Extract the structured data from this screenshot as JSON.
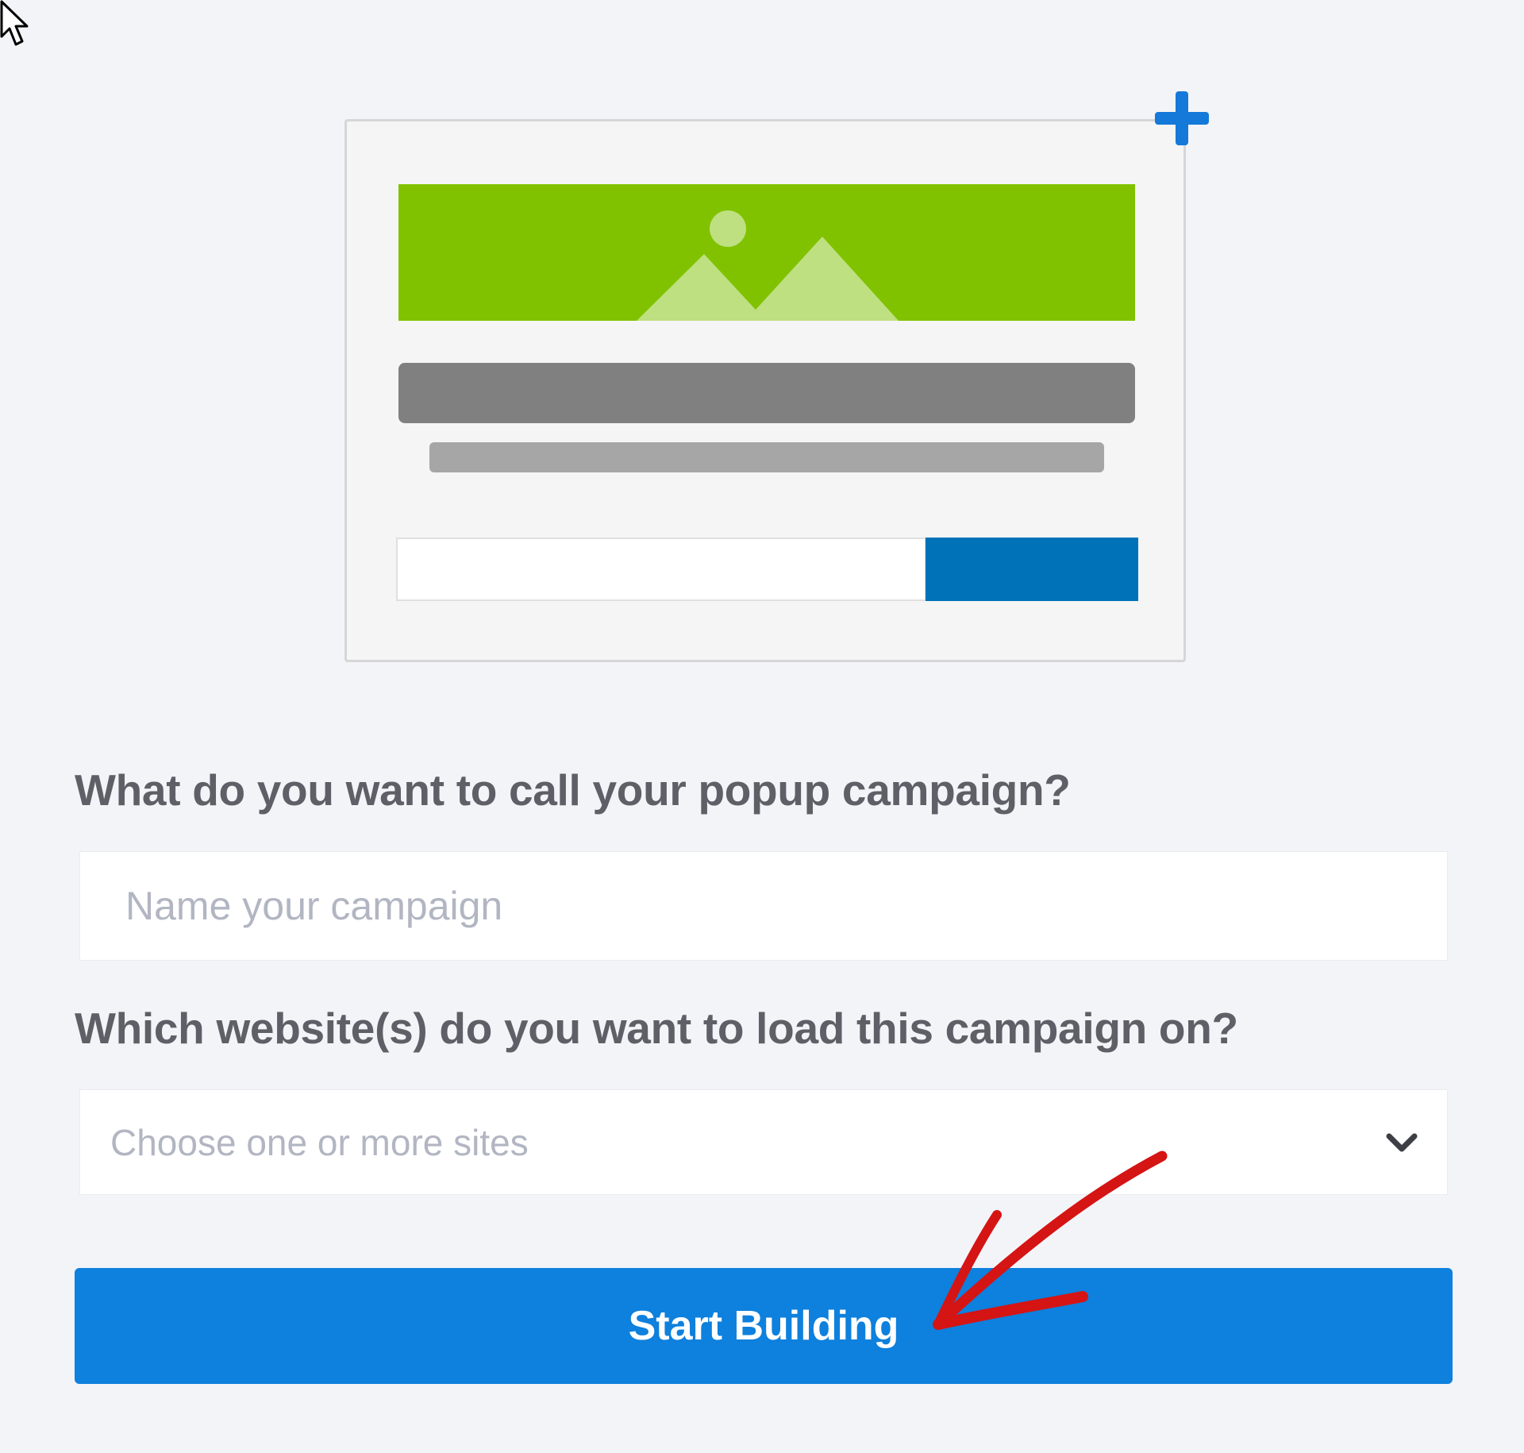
{
  "form": {
    "name_label": "What do you want to call your popup campaign?",
    "name_placeholder": "Name your campaign",
    "name_value": "",
    "sites_label": "Which website(s) do you want to load this campaign on?",
    "sites_placeholder": "Choose one or more sites",
    "submit_label": "Start Building"
  },
  "colors": {
    "page_background": "#f3f4f8",
    "primary_button": "#0e80dd",
    "label_text": "#5d6066",
    "placeholder_text": "#b2b6c2",
    "illustration_image": "#80c200",
    "illustration_button": "#0072b8",
    "plus_icon": "#1479d8",
    "annotation": "#d51414"
  },
  "icons": {
    "cursor": "mouse-pointer-icon",
    "add": "plus-icon",
    "image": "image-placeholder-icon",
    "dropdown": "chevron-down-icon",
    "annotation": "hand-drawn-arrow"
  }
}
